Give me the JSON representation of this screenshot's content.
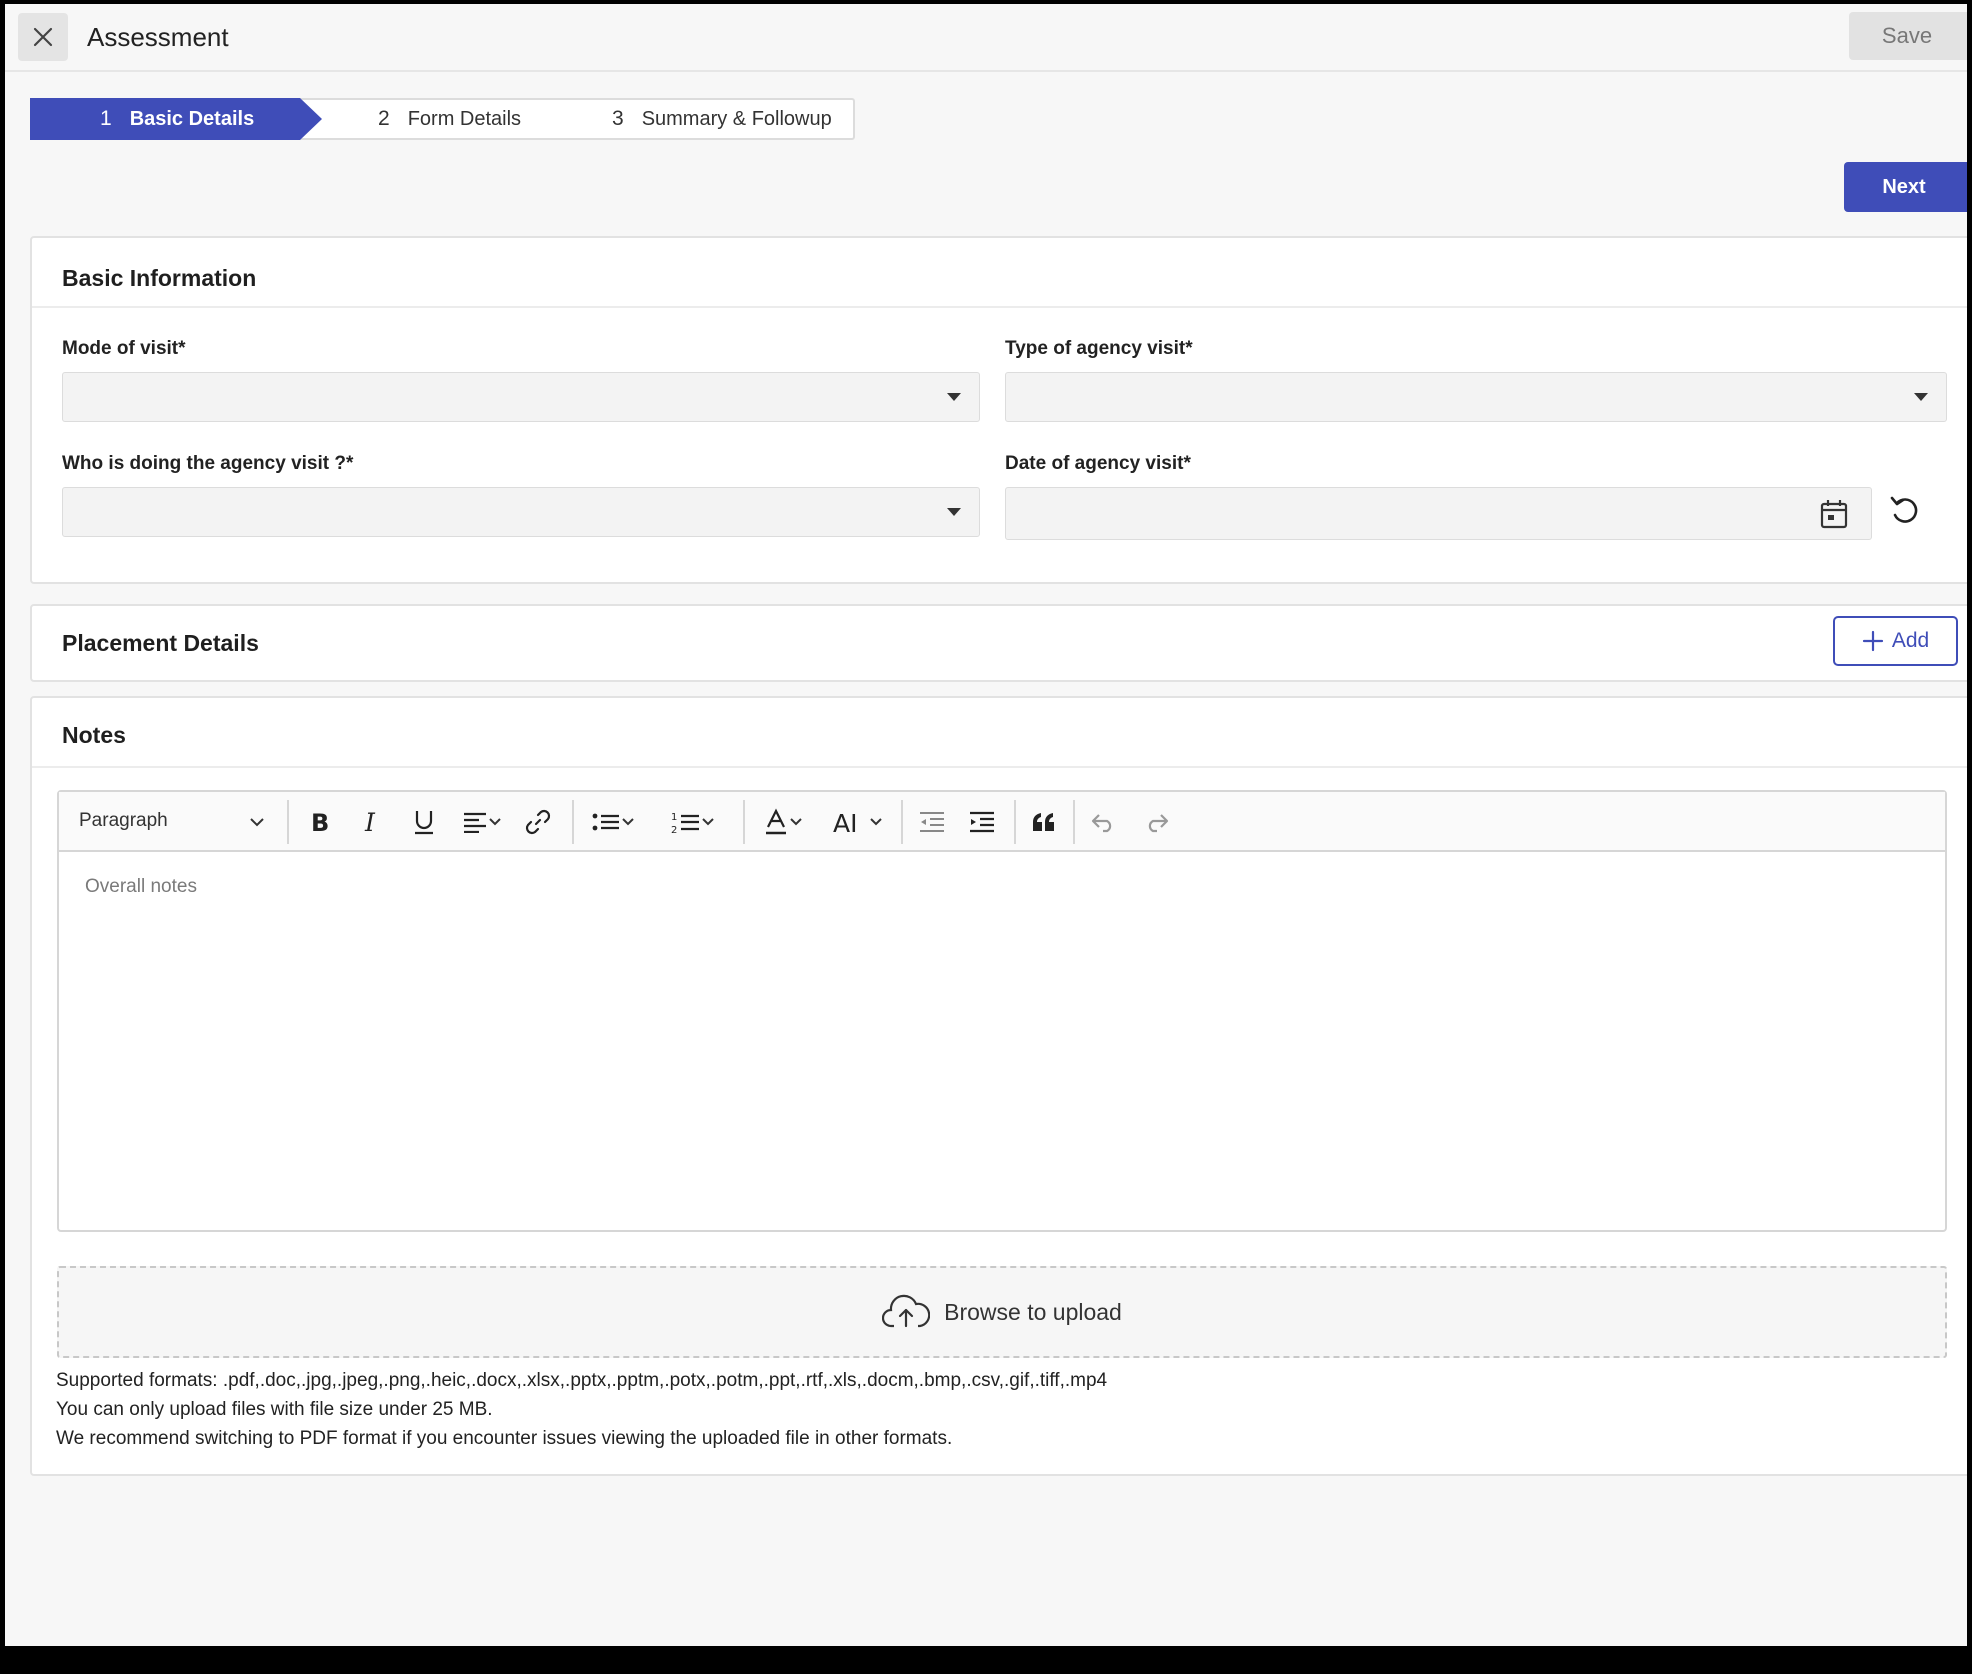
{
  "header": {
    "title": "Assessment",
    "save_label": "Save"
  },
  "stepper": {
    "steps": [
      {
        "num": "1",
        "label": "Basic Details",
        "active": true
      },
      {
        "num": "2",
        "label": "Form Details",
        "active": false
      },
      {
        "num": "3",
        "label": "Summary & Followup",
        "active": false
      }
    ]
  },
  "next_label": "Next",
  "basic_info": {
    "title": "Basic Information",
    "fields": {
      "mode": {
        "label": "Mode of visit",
        "value": ""
      },
      "type": {
        "label": "Type of agency visit",
        "value": ""
      },
      "who": {
        "label": "Who is doing the agency visit ?",
        "value": ""
      },
      "date": {
        "label": "Date of agency visit",
        "value": ""
      }
    },
    "required_mark": "*"
  },
  "placement": {
    "title": "Placement Details",
    "add_label": "Add"
  },
  "notes": {
    "title": "Notes",
    "paragraph_label": "Paragraph",
    "placeholder": "Overall notes",
    "upload_label": "Browse to upload",
    "supported_formats": "Supported formats: .pdf,.doc,.jpg,.jpeg,.png,.heic,.docx,.xlsx,.pptx,.pptm,.potx,.potm,.ppt,.rtf,.xls,.docm,.bmp,.csv,.gif,.tiff,.mp4",
    "size_note": "You can only upload files with file size under 25 MB.",
    "pdf_note": "We recommend switching to PDF format if you encounter issues viewing the uploaded file in other formats."
  },
  "colors": {
    "accent": "#3f4db8",
    "background": "#f7f7f7"
  }
}
